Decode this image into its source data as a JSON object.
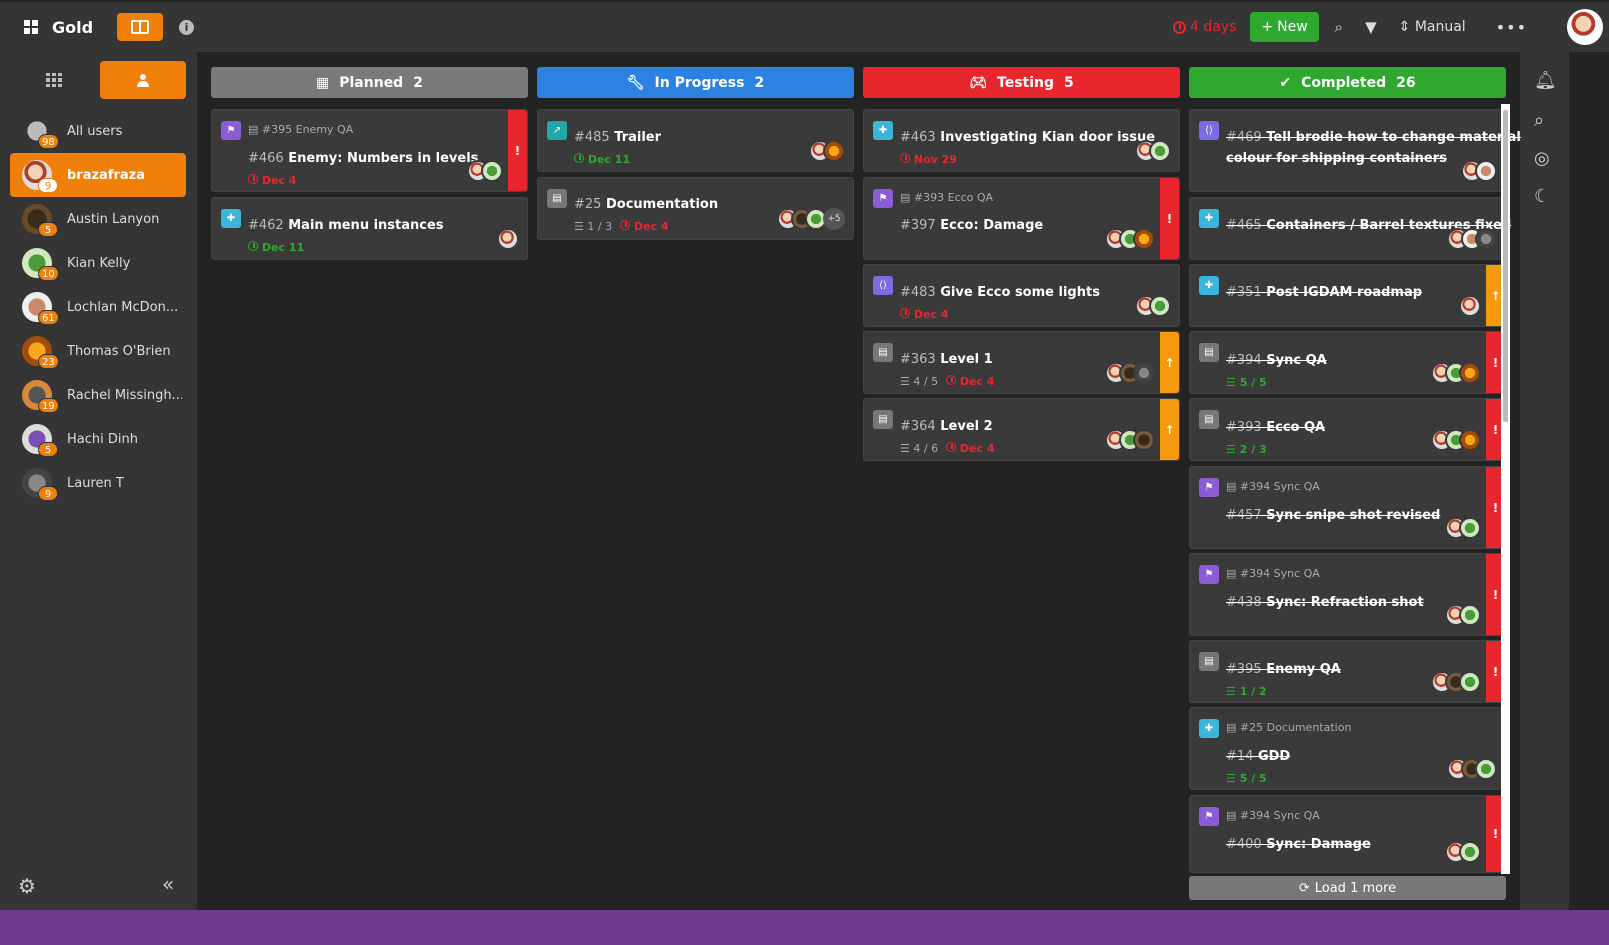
{
  "header": {
    "title": "Gold",
    "deadline": "4 days",
    "new_label": "New",
    "sort_label": "Manual"
  },
  "colors": {
    "accent": "#f0800a",
    "planned": "#7a7a7a",
    "in_progress": "#2b82e0",
    "testing": "#e8262d",
    "completed": "#2ea82e"
  },
  "sidebar": {
    "users": [
      {
        "name": "All users",
        "count": "98",
        "active": false
      },
      {
        "name": "brazafraza",
        "count": "9",
        "active": true
      },
      {
        "name": "Austin Lanyon",
        "count": "5",
        "active": false
      },
      {
        "name": "Kian Kelly",
        "count": "10",
        "active": false
      },
      {
        "name": "Lochlan McDon...",
        "count": "61",
        "active": false
      },
      {
        "name": "Thomas O'Brien",
        "count": "23",
        "active": false
      },
      {
        "name": "Rachel Missingh...",
        "count": "19",
        "active": false
      },
      {
        "name": "Hachi Dinh",
        "count": "5",
        "active": false
      },
      {
        "name": "Lauren T",
        "count": "9",
        "active": false
      }
    ]
  },
  "columns": [
    {
      "name": "Planned",
      "count": "2",
      "icon": "calendar-icon"
    },
    {
      "name": "In Progress",
      "count": "2",
      "icon": "wrench-icon"
    },
    {
      "name": "Testing",
      "count": "5",
      "icon": "gamepad-icon"
    },
    {
      "name": "Completed",
      "count": "26",
      "icon": "check-icon"
    }
  ],
  "cards": [
    {
      "parent": "#395 Enemy QA",
      "num": "#466",
      "title": "Enemy: Numbers in levels",
      "date": "Dec 4",
      "flag": "!"
    },
    {
      "num": "#462",
      "title": "Main menu instances",
      "date": "Dec 11"
    },
    {
      "num": "#485",
      "title": "Trailer",
      "date": "Dec 11"
    },
    {
      "num": "#25",
      "title": "Documentation",
      "sub": "1 / 3",
      "date": "Dec 4",
      "more": "+5"
    },
    {
      "num": "#463",
      "title": "Investigating Kian door issue",
      "date": "Nov 29"
    },
    {
      "parent": "#393 Ecco QA",
      "num": "#397",
      "title": "Ecco: Damage",
      "flag": "!"
    },
    {
      "num": "#483",
      "title": "Give Ecco some lights",
      "date": "Dec 4"
    },
    {
      "num": "#363",
      "title": "Level 1",
      "sub": "4 / 5",
      "date": "Dec 4",
      "flag": "↑"
    },
    {
      "num": "#364",
      "title": "Level 2",
      "sub": "4 / 6",
      "date": "Dec 4",
      "flag": "↑"
    },
    {
      "num": "#469",
      "title": "Tell brodie how to change material",
      "title2": "colour for shipping containers"
    },
    {
      "num": "#465",
      "title": "Containers / Barrel textures fixed"
    },
    {
      "num": "#351",
      "title": "Post IGDAM roadmap",
      "flag": "↑"
    },
    {
      "num": "#394",
      "title": "Sync QA",
      "sub": "5 / 5",
      "flag": "!"
    },
    {
      "num": "#393",
      "title": "Ecco QA",
      "sub": "2 / 3",
      "flag": "!"
    },
    {
      "parent": "#394 Sync QA",
      "num": "#457",
      "title": "Sync snipe shot revised",
      "flag": "!"
    },
    {
      "parent": "#394 Sync QA",
      "num": "#438",
      "title": "Sync: Refraction shot",
      "flag": "!"
    },
    {
      "num": "#395",
      "title": "Enemy QA",
      "sub": "1 / 2",
      "flag": "!"
    },
    {
      "parent": "#25 Documentation",
      "num": "#14",
      "title": "GDD",
      "sub": "5 / 5"
    },
    {
      "parent": "#394 Sync QA",
      "num": "#400",
      "title": "Sync: Damage",
      "flag": "!"
    }
  ],
  "load_more": "Load 1 more"
}
